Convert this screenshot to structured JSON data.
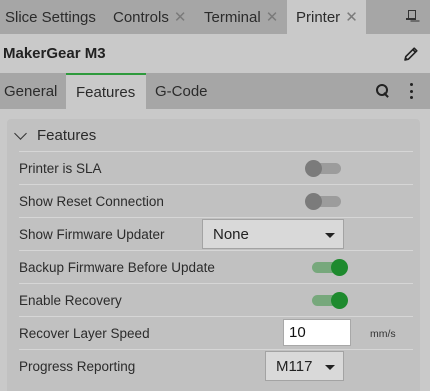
{
  "tabs": [
    {
      "label": "Slice Settings"
    },
    {
      "label": "Controls",
      "close": "✕"
    },
    {
      "label": "Terminal",
      "close": "✕"
    },
    {
      "label": "Printer",
      "close": "✕"
    }
  ],
  "printer": {
    "name": "MakerGear M3"
  },
  "subtabs": [
    {
      "label": "General"
    },
    {
      "label": "Features"
    },
    {
      "label": "G-Code"
    }
  ],
  "section": {
    "title": "Features"
  },
  "settings": [
    {
      "label": "Printer is SLA",
      "type": "toggle",
      "value": false
    },
    {
      "label": "Show Reset Connection",
      "type": "toggle",
      "value": false
    },
    {
      "label": "Show Firmware Updater",
      "type": "dropdown",
      "value": "None"
    },
    {
      "label": "Backup Firmware Before Update",
      "type": "toggle",
      "value": true
    },
    {
      "label": "Enable Recovery",
      "type": "toggle",
      "value": true
    },
    {
      "label": "Recover Layer Speed",
      "type": "number",
      "value": "10",
      "units": "mm/s"
    },
    {
      "label": "Progress Reporting",
      "type": "dropdown",
      "value": "M117"
    }
  ],
  "colors": {
    "accent": "#2e9a3c",
    "toggle_on": "#1e8a2e"
  }
}
